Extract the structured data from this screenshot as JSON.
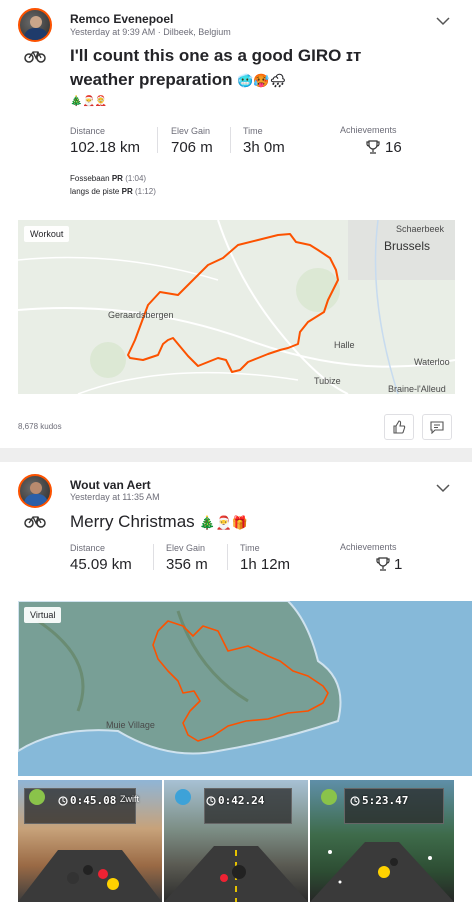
{
  "activities": [
    {
      "athlete": "Remco Evenepoel",
      "meta": "Yesterday at 9:39 AM · Dilbeek, Belgium",
      "title": "I'll count this one as a good GIRO ɪᴛ",
      "title_line2": "weather preparation",
      "title_emojis": "🥶🥵🌧",
      "sub_emojis": "🎄🎅🤶",
      "stats": [
        {
          "label": "Distance",
          "value": "102.18 km"
        },
        {
          "label": "Elev Gain",
          "value": "706 m"
        },
        {
          "label": "Time",
          "value": "3h 0m"
        }
      ],
      "achievements_label": "Achievements",
      "achievements_count": "16",
      "segments": [
        {
          "name": "Fossebaan",
          "pr": "PR",
          "time": "(1:04)"
        },
        {
          "name": "langs de piste",
          "pr": "PR",
          "time": "(1:12)"
        }
      ],
      "map_tag": "Workout",
      "places": [
        "Schaerbeek",
        "Brussels",
        "Geraardsbergen",
        "Halle",
        "Waterloo",
        "Tubize",
        "Braine-l'Alleud"
      ],
      "kudos": "8,678 kudos"
    },
    {
      "athlete": "Wout van Aert",
      "meta": "Yesterday at 11:35 AM",
      "title": "Merry Christmas",
      "title_emojis": "🎄🎅🎁",
      "stats": [
        {
          "label": "Distance",
          "value": "45.09 km"
        },
        {
          "label": "Elev Gain",
          "value": "356 m"
        },
        {
          "label": "Time",
          "value": "1h 12m"
        }
      ],
      "achievements_label": "Achievements",
      "achievements_count": "1",
      "map_tag": "Virtual",
      "places": [
        "Muie Village"
      ],
      "photos": [
        {
          "time": "0:45.08",
          "label": "Zwift"
        },
        {
          "time": "0:42.24"
        },
        {
          "time": "5:23.47"
        }
      ]
    }
  ],
  "colors": {
    "route": "#fc5200",
    "brand": "#fc5200",
    "map_land": "#e8ede4",
    "sea": "#7fb3d5"
  }
}
